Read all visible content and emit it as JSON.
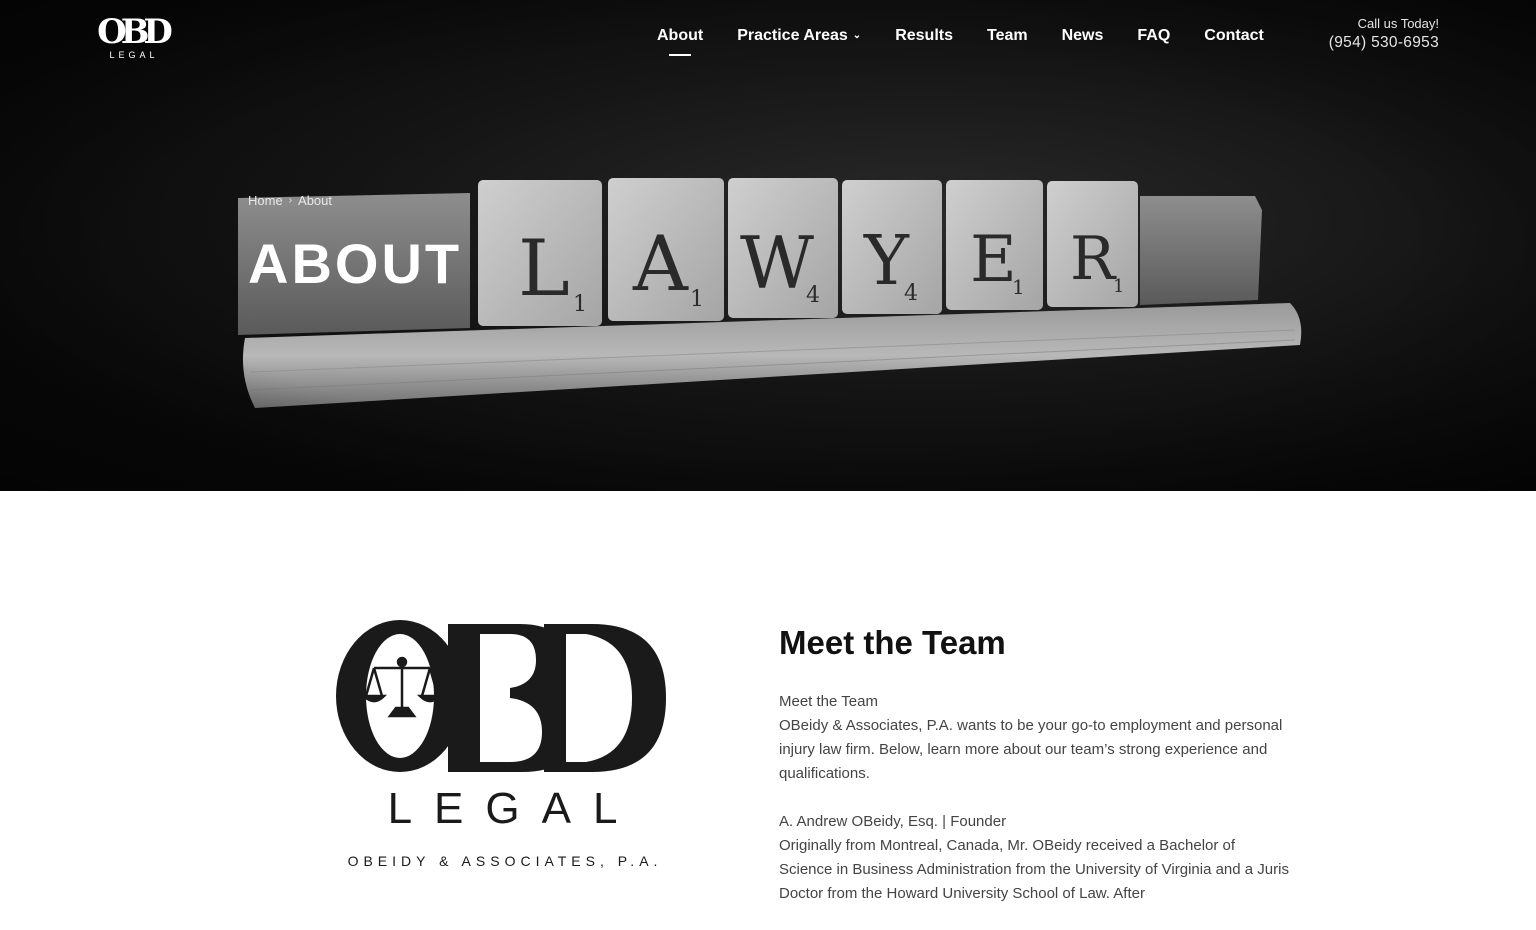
{
  "logo_small": {
    "mark": "OBD",
    "word": "LEGAL"
  },
  "nav": {
    "items": [
      {
        "label": "About",
        "active": true
      },
      {
        "label": "Practice Areas",
        "dropdown": true
      },
      {
        "label": "Results"
      },
      {
        "label": "Team"
      },
      {
        "label": "News"
      },
      {
        "label": "FAQ"
      },
      {
        "label": "Contact"
      }
    ],
    "call_label": "Call us Today!",
    "phone": "(954) 530-6953"
  },
  "hero": {
    "breadcrumb": {
      "home": "Home",
      "current": "About"
    },
    "title": "ABOUT",
    "tiles": [
      {
        "letter": "L",
        "score": "1"
      },
      {
        "letter": "A",
        "score": "1"
      },
      {
        "letter": "W",
        "score": "4"
      },
      {
        "letter": "Y",
        "score": "4"
      },
      {
        "letter": "E",
        "score": "1"
      },
      {
        "letter": "R",
        "score": "1"
      }
    ]
  },
  "logo_large": {
    "mark": "OBD",
    "word": "LEGAL",
    "subtitle": "OBEIDY & ASSOCIATES, P.A."
  },
  "team": {
    "heading": "Meet the Team",
    "intro_title": "Meet the Team",
    "intro": "OBeidy & Associates, P.A. wants to be your go-to employment and personal injury law firm. Below, learn more about our team’s strong experience and qualifications.",
    "founder_title": "A. Andrew OBeidy, Esq. | Founder",
    "founder_bio": "Originally from Montreal, Canada, Mr. OBeidy received a Bachelor of Science in Business Administration from the University of Virginia and a Juris Doctor from the Howard University School of Law. After"
  },
  "colors": {
    "hero_bg": "#111111",
    "text_dark": "#111111",
    "text_body": "#444444",
    "white": "#ffffff"
  },
  "icons": {
    "dropdown": "chevron-down-icon",
    "scales": "scales-of-justice-icon"
  }
}
